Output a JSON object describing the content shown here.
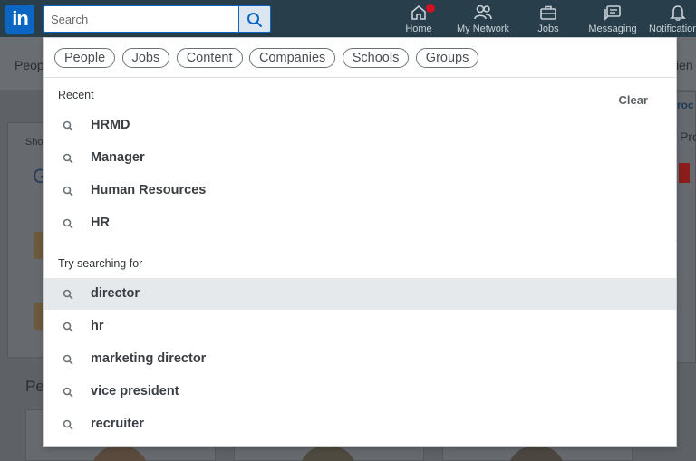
{
  "header": {
    "logo_text": "in",
    "search": {
      "placeholder": "Search"
    },
    "nav": [
      {
        "label": "Home",
        "icon": "home-icon",
        "has_badge": true
      },
      {
        "label": "My Network",
        "icon": "network-icon"
      },
      {
        "label": "Jobs",
        "icon": "briefcase-icon"
      },
      {
        "label": "Messaging",
        "icon": "messaging-icon"
      },
      {
        "label": "Notifications",
        "icon": "bell-icon"
      }
    ]
  },
  "background": {
    "left_tab_partial": "Peop",
    "right_tab_partial": "ien",
    "right_link_partial": "roc",
    "right_heading_partial": "Pro",
    "card_small_partial": "Sho",
    "card_logo_partial": "G",
    "section_heading_partial": "Pe"
  },
  "dropdown": {
    "filters": [
      "People",
      "Jobs",
      "Content",
      "Companies",
      "Schools",
      "Groups"
    ],
    "recent_title": "Recent",
    "clear_label": "Clear",
    "recent": [
      "HRMD",
      "Manager",
      "Human Resources",
      "HR"
    ],
    "try_title": "Try searching for",
    "suggestions": [
      "director",
      "hr",
      "marketing director",
      "vice president",
      "recruiter"
    ],
    "active_suggestion_index": 0
  },
  "colors": {
    "nav_bar": "#283e4a",
    "brand_blue": "#0a66c2",
    "badge_red": "#d11124",
    "active_row": "#e6e9ec"
  }
}
